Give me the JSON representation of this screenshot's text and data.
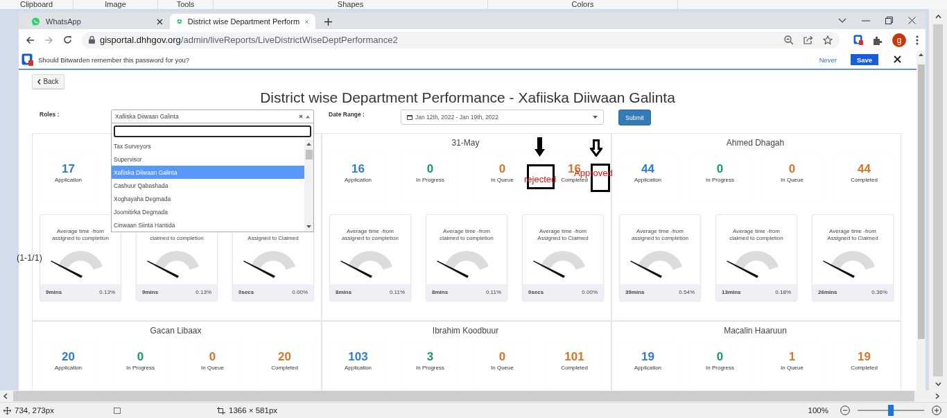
{
  "ribbon": [
    "Clipboard",
    "Image",
    "Tools",
    "Shapes",
    "Colors"
  ],
  "browser": {
    "tabs": [
      {
        "title": "WhatsApp",
        "selected": false,
        "kind": "chat"
      },
      {
        "title": "District wise Department Perform",
        "selected": true,
        "kind": "site"
      }
    ],
    "url_domain": "gisportal.dhhgov.org",
    "url_path": "/admin/liveReports/LiveDistrictWiseDeptPerformance2",
    "profile_initial": "g"
  },
  "password_bar": {
    "message": "Should Bitwarden remember this password for you?",
    "never": "Never",
    "save": "Save"
  },
  "page": {
    "back": "Back",
    "title": "District wise Department Performance - Xafiiska Diiwaan Galinta",
    "roles_label": "Roles :",
    "role_select": {
      "value": "Xafiiska Diiwaan Galinta",
      "expanded": true,
      "options": [
        {
          "label": "Tax Surveyors",
          "selected": false
        },
        {
          "label": "Supervisor",
          "selected": false
        },
        {
          "label": "Xafiiska Diiwaan Galinta",
          "selected": true
        },
        {
          "label": "Cashuur Qabashada",
          "selected": false
        },
        {
          "label": "Xoghayaha Degmada",
          "selected": false
        },
        {
          "label": "Joomitirka Degmada",
          "selected": false
        },
        {
          "label": "Cinwaan Siinta Hantida",
          "selected": false
        }
      ]
    },
    "date_label": "Date Range :",
    "date_range": "Jan 12th, 2022 - Jan 19th, 2022",
    "submit": "Submit"
  },
  "panels": [
    {
      "stats": [
        {
          "kind": "application",
          "value": "17",
          "label": "Application"
        }
      ],
      "gauges": [
        {
          "title_lines": [
            "Average time -from",
            "assigned to completion"
          ],
          "value": "9mins",
          "percent": "0.13%"
        },
        {
          "title_lines": [
            "claimed to completion"
          ],
          "value": "9mins",
          "percent": "0.13%"
        },
        {
          "title_lines": [
            "Assigned to Claimed"
          ],
          "value": "0secs",
          "percent": "0.00%"
        }
      ]
    },
    {
      "name": "31-May",
      "stats": [
        {
          "kind": "application",
          "value": "16",
          "label": "Application"
        },
        {
          "kind": "in_progress",
          "value": "0",
          "label": "In Progress"
        },
        {
          "kind": "in_queue",
          "value": "0",
          "label": "In Queue"
        },
        {
          "kind": "completed",
          "value": "16",
          "label": "Completed"
        }
      ],
      "gauges": [
        {
          "title_lines": [
            "Average time -from",
            "assigned to completion"
          ],
          "value": "8mins",
          "percent": "0.11%"
        },
        {
          "title_lines": [
            "Average time -from",
            "claimed to completion"
          ],
          "value": "8mins",
          "percent": "0.11%"
        },
        {
          "title_lines": [
            "Average time -from",
            "Assigned to Claimed"
          ],
          "value": "0secs",
          "percent": "0.00%"
        }
      ]
    },
    {
      "name": "Ahmed Dhagah",
      "stats": [
        {
          "kind": "application",
          "value": "44",
          "label": "Application"
        },
        {
          "kind": "in_progress",
          "value": "0",
          "label": "In Progress"
        },
        {
          "kind": "in_queue",
          "value": "0",
          "label": "In Queue"
        },
        {
          "kind": "completed",
          "value": "44",
          "label": "Completed"
        }
      ],
      "gauges": [
        {
          "title_lines": [
            "Average time -from",
            "assigned to completion"
          ],
          "value": "39mins",
          "percent": "0.54%"
        },
        {
          "title_lines": [
            "Average time -from",
            "claimed to completion"
          ],
          "value": "13mins",
          "percent": "0.18%"
        },
        {
          "title_lines": [
            "Average time -from",
            "Assigned to Claimed"
          ],
          "value": "26mins",
          "percent": "0.36%"
        }
      ]
    },
    {
      "name": "Gacan Libaax",
      "stats": [
        {
          "kind": "application",
          "value": "20",
          "label": "Application"
        },
        {
          "kind": "in_progress",
          "value": "0",
          "label": "In Progress"
        },
        {
          "kind": "in_queue",
          "value": "0",
          "label": "In Queue"
        },
        {
          "kind": "completed",
          "value": "20",
          "label": "Completed"
        }
      ]
    },
    {
      "name": "Ibrahim Koodbuur",
      "stats": [
        {
          "kind": "application",
          "value": "103",
          "label": "Application"
        },
        {
          "kind": "in_progress",
          "value": "3",
          "label": "In Progress"
        },
        {
          "kind": "in_queue",
          "value": "0",
          "label": "In Queue"
        },
        {
          "kind": "completed",
          "value": "101",
          "label": "Completed"
        }
      ]
    },
    {
      "name": "Macalin Haaruun",
      "stats": [
        {
          "kind": "application",
          "value": "19",
          "label": "Application"
        },
        {
          "kind": "in_progress",
          "value": "0",
          "label": "In Progress"
        },
        {
          "kind": "in_queue",
          "value": "1",
          "label": "In Queue"
        },
        {
          "kind": "completed",
          "value": "19",
          "label": "Completed"
        }
      ]
    }
  ],
  "annotations": [
    {
      "kind": "note",
      "text": "(1-1/1)"
    },
    {
      "kind": "solid_arrow"
    },
    {
      "kind": "hollow_arrow"
    },
    {
      "kind": "box"
    },
    {
      "kind": "box"
    },
    {
      "kind": "label",
      "text": "rejected"
    },
    {
      "kind": "label",
      "text": "Approved"
    }
  ],
  "status_bar": {
    "cursor": "734, 273px",
    "canvas_size": "1366 × 581px",
    "zoom": "100%",
    "zoom_slider": {
      "level": 0.5
    }
  }
}
